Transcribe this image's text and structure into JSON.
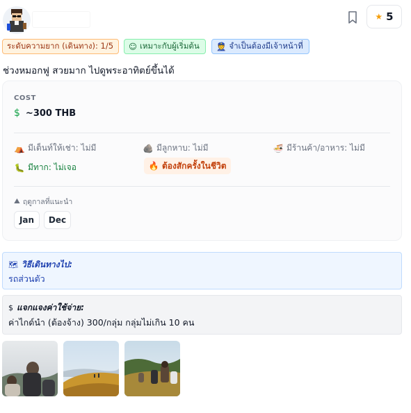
{
  "header": {
    "avatar_icon": "avatar-icon",
    "bookmark_icon": "bookmark-icon",
    "rating": {
      "star_icon": "star-icon",
      "value": "5"
    }
  },
  "badges": [
    {
      "label": "ระดับความยาก (เดินทาง): 1/5"
    },
    {
      "icon": "smile-icon",
      "label": "เหมาะกับผู้เริ่มต้น"
    },
    {
      "icon": "guide-icon",
      "label": "จำเป็นต้องมีเจ้าหน้าที่"
    }
  ],
  "description": "ช่วงหมอกฟู สวยมาก ไปดูพระอาทิตย์ขึ้นได้",
  "details": {
    "cost_label": "COST",
    "cost_value": "~300 THB",
    "facilities": [
      {
        "icon": "tent-icon",
        "label": "มีเต็นท์ให้เช่า: ไม่มี"
      },
      {
        "icon": "rock-icon",
        "label": "มีลูกหาบ: ไม่มี"
      },
      {
        "icon": "food-icon",
        "label": "มีร้านค้า/อาหาร: ไม่มี"
      },
      {
        "icon": "leech-icon",
        "label": "มีทาก: ไม่เจอ"
      },
      {
        "icon": "fire-icon",
        "label": "ต้องสักครั้งในชีวิต"
      }
    ],
    "season_label": "ฤดูกาลที่แนะนำ",
    "months": [
      "Jan",
      "Dec"
    ]
  },
  "route": {
    "title": "วิธีเดินทางไป:",
    "body": "รถส่วนตัว"
  },
  "expenses": {
    "title": "แจกแจงค่าใช้จ่าย:",
    "body": "ค่าไกด์นำ (ต้องจ้าง) 300/กลุ่ม กลุ่มไม่เกิน 10 คน"
  },
  "colors": {
    "accent_blue": "#1e40af",
    "star": "#f59e0b",
    "cost_green": "#16a34a"
  }
}
